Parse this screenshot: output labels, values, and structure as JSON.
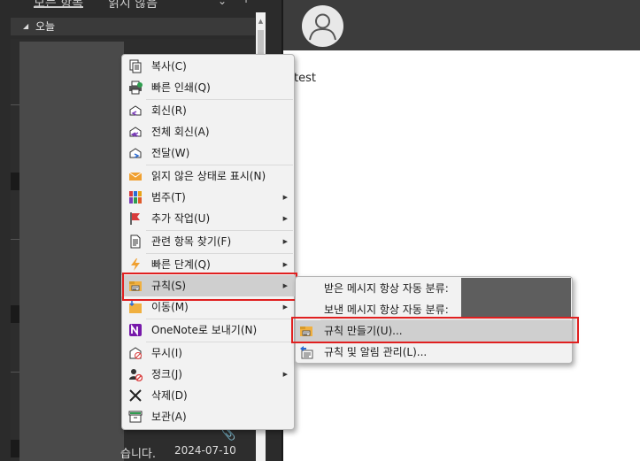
{
  "list_header": {
    "filter_all": "모든 항목",
    "filter_unread": "읽지 않음",
    "chevron_icon": "chevron-down-icon",
    "sort_icon": "arrow-up-icon"
  },
  "group": {
    "label": "오늘"
  },
  "message": {
    "preview": "습니다.",
    "date": "2024-07-10"
  },
  "reading_pane": {
    "body_text": "test"
  },
  "context_menu": {
    "items": [
      {
        "label": "복사(C)",
        "icon": "copy-icon",
        "submenu": false
      },
      {
        "label": "빠른 인쇄(Q)",
        "icon": "print-icon",
        "submenu": false
      },
      {
        "label": "회신(R)",
        "icon": "reply-icon",
        "submenu": false
      },
      {
        "label": "전체 회신(A)",
        "icon": "reply-all-icon",
        "submenu": false
      },
      {
        "label": "전달(W)",
        "icon": "forward-icon",
        "submenu": false
      },
      {
        "label": "읽지 않은 상태로 표시(N)",
        "icon": "envelope-icon",
        "submenu": false
      },
      {
        "label": "범주(T)",
        "icon": "categories-icon",
        "submenu": true
      },
      {
        "label": "추가 작업(U)",
        "icon": "flag-icon",
        "submenu": true
      },
      {
        "label": "관련 항목 찾기(F)",
        "icon": "find-related-icon",
        "submenu": true
      },
      {
        "label": "빠른 단계(Q)",
        "icon": "lightning-icon",
        "submenu": true
      },
      {
        "label": "규칙(S)",
        "icon": "rules-icon",
        "submenu": true
      },
      {
        "label": "이동(M)",
        "icon": "move-icon",
        "submenu": true
      },
      {
        "label": "OneNote로 보내기(N)",
        "icon": "onenote-icon",
        "submenu": false
      },
      {
        "label": "무시(I)",
        "icon": "ignore-icon",
        "submenu": false
      },
      {
        "label": "정크(J)",
        "icon": "junk-icon",
        "submenu": true
      },
      {
        "label": "삭제(D)",
        "icon": "delete-icon",
        "submenu": false
      },
      {
        "label": "보관(A)",
        "icon": "archive-icon",
        "submenu": false
      }
    ]
  },
  "rules_submenu": {
    "items": [
      {
        "label": "받은 메시지 항상 자동 분류:",
        "icon": ""
      },
      {
        "label": "보낸 메시지 항상 자동 분류:",
        "icon": ""
      },
      {
        "label": "규칙 만들기(U)...",
        "icon": "create-rule-icon"
      },
      {
        "label": "규칙 및 알림 관리(L)...",
        "icon": "manage-rules-icon"
      }
    ]
  },
  "colors": {
    "highlight_border": "#e02020",
    "menu_bg": "#f2f2f2",
    "menu_hover": "#cfcfcf",
    "onenote_purple": "#7719aa",
    "envelope_orange": "#f0a030"
  }
}
